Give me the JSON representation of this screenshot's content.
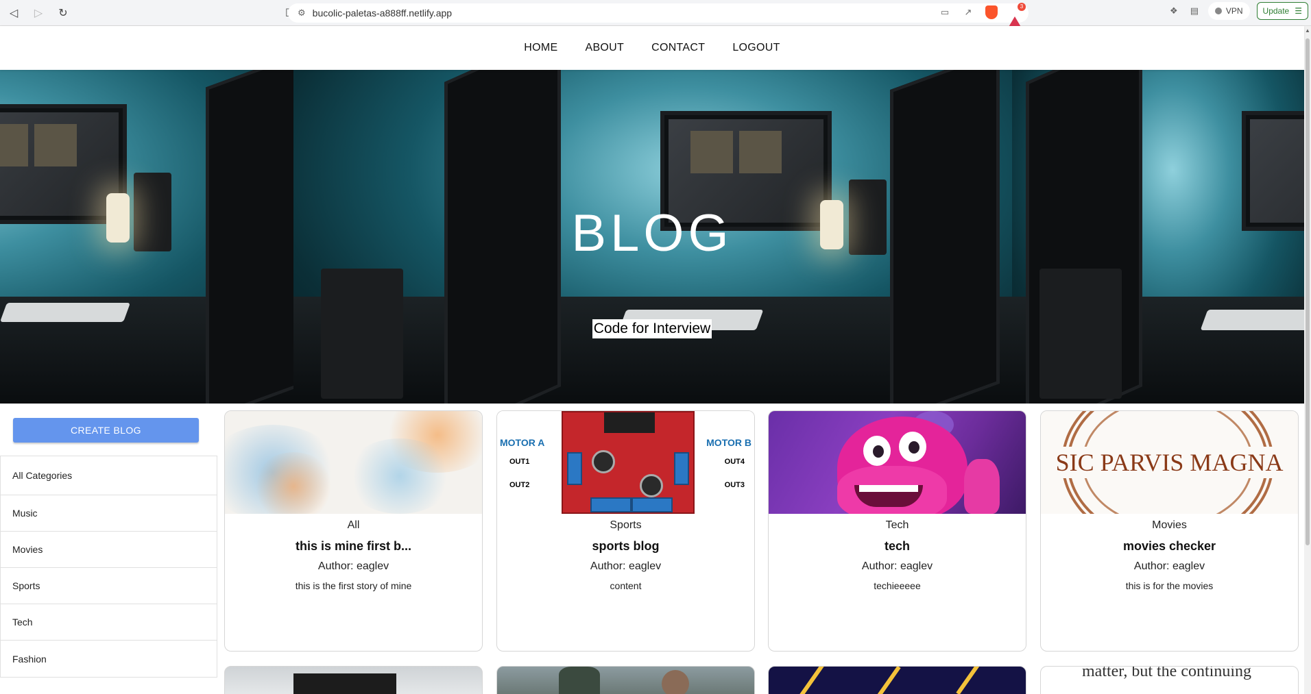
{
  "browser": {
    "url": "bucolic-paletas-a888ff.netlify.app",
    "vpn_label": "VPN",
    "update_label": "Update",
    "rewards_badge": "3"
  },
  "nav": {
    "items": [
      "HOME",
      "ABOUT",
      "CONTACT",
      "LOGOUT"
    ]
  },
  "hero": {
    "title": "BLOG",
    "subtitle": "Code for Interview"
  },
  "sidebar": {
    "create_label": "CREATE BLOG",
    "categories": [
      "All Categories",
      "Music",
      "Movies",
      "Sports",
      "Tech",
      "Fashion"
    ]
  },
  "posts": [
    {
      "category": "All",
      "title": "this is mine first b...",
      "author": "Author: eaglev",
      "description": "this is the first story of mine",
      "image": "watercolor-splash"
    },
    {
      "category": "Sports",
      "title": "sports blog",
      "author": "Author: eaglev",
      "description": "content",
      "image": "motor-driver-board"
    },
    {
      "category": "Tech",
      "title": "tech",
      "author": "Author: eaglev",
      "description": "techieeeee",
      "image": "pink-dragon"
    },
    {
      "category": "Movies",
      "title": "movies checker",
      "author": "Author: eaglev",
      "description": "this is for the movies",
      "image": "sic-parvis-magna-seal"
    }
  ],
  "motor_image_labels": {
    "motor_a": "MOTOR A",
    "motor_b": "MOTOR B",
    "out1": "OUT1",
    "out2": "OUT2",
    "out3": "OUT3",
    "out4": "OUT4"
  },
  "seal_text": "SIC PARVIS MAGNA",
  "partial_card_text": "matter, but the continuing",
  "colors": {
    "create_button": "#6495ed",
    "update_button": "#2e7d32",
    "brave_icon": "#fb542b"
  }
}
